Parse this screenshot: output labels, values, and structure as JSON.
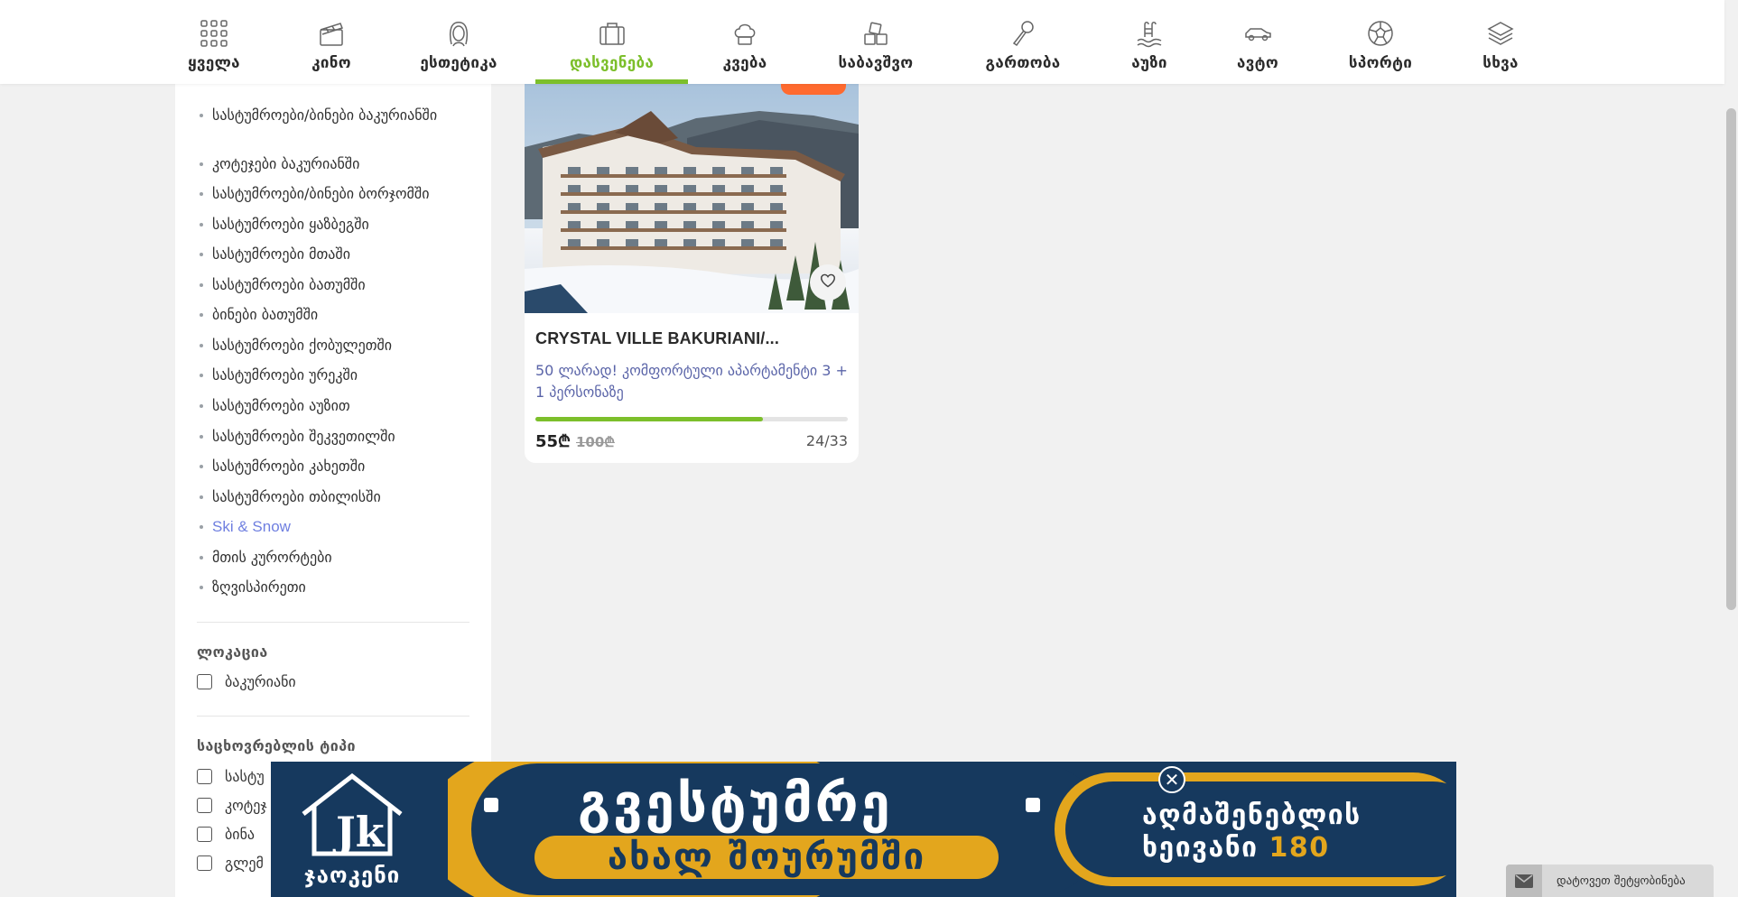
{
  "nav": {
    "items": [
      {
        "label": "ყველა",
        "icon": "grid-icon"
      },
      {
        "label": "კინო",
        "icon": "clapperboard-icon"
      },
      {
        "label": "ესთეტიკა",
        "icon": "woman-face-icon"
      },
      {
        "label": "დასვენება",
        "icon": "suitcase-icon",
        "active": true
      },
      {
        "label": "კვება",
        "icon": "chef-hat-icon"
      },
      {
        "label": "საბავშვო",
        "icon": "toy-blocks-icon"
      },
      {
        "label": "გართობა",
        "icon": "microphone-icon"
      },
      {
        "label": "აუზი",
        "icon": "pool-ladder-icon"
      },
      {
        "label": "ავტო",
        "icon": "car-icon"
      },
      {
        "label": "სპორტი",
        "icon": "soccer-ball-icon"
      },
      {
        "label": "სხვა",
        "icon": "layers-icon"
      }
    ],
    "accent_color": "#7cbf2b"
  },
  "sidebar": {
    "categories": [
      "სასტუმროები/ბინები ბაკურიანში",
      "კოტეჯები ბაკურიანში",
      "სასტუმროები/ბინები ბორჯომში",
      "სასტუმროები ყაზბეგში",
      "სასტუმროები მთაში",
      "სასტუმროები ბათუმში",
      "ბინები ბათუმში",
      "სასტუმროები ქობულეთში",
      "სასტუმროები ურეკში",
      "სასტუმროები აუზით",
      "სასტუმროები შეკვეთილში",
      "სასტუმროები კახეთში",
      "სასტუმროები თბილისში",
      "Ski & Snow",
      "მთის კურორტები",
      "ზღვისპირეთი"
    ],
    "active_category": "Ski & Snow",
    "location": {
      "heading": "ლოკაცია",
      "options": [
        "ბაკურიანი"
      ]
    },
    "accommodation": {
      "heading": "საცხოვრებლის ტიპი",
      "options": [
        "სასტუ",
        "კოტეჯ",
        "ბინა",
        "გლემ"
      ]
    }
  },
  "product": {
    "title": "CRYSTAL VILLE BAKURIANI/...",
    "description": "50 ლარად! კომფორტული აპარტამენტი 3 + 1 პერსონაზე",
    "price": "55₾",
    "old_price": "100₾",
    "sold": "24/33",
    "progress_fraction": 0.727
  },
  "banner": {
    "logo_text": "ჯაოკენი",
    "headline": "გვესტუმრე",
    "subline": "ახალ შოურუმში",
    "right_line1": "აღმაშენებლის",
    "right_line2_prefix": "ხეივანი",
    "right_line2_number": "180",
    "colors": {
      "navy": "#16395e",
      "gold": "#e3a61d"
    }
  },
  "message_widget": {
    "label": "დატოვეთ შეტყობინება"
  }
}
